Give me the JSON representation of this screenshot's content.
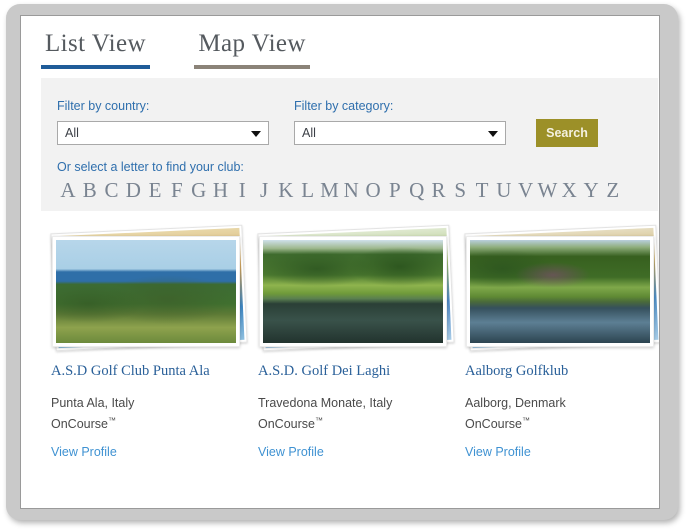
{
  "tabs": [
    {
      "label": "List View",
      "active": true
    },
    {
      "label": "Map View",
      "active": false
    }
  ],
  "filters": {
    "country": {
      "label": "Filter by country:",
      "value": "All",
      "caret_icon": "chevron-down-icon"
    },
    "category": {
      "label": "Filter by category:",
      "value": "All",
      "caret_icon": "chevron-down-icon"
    },
    "search_button": "Search",
    "letter_prompt": "Or select a letter to find your club:",
    "letters": [
      "A",
      "B",
      "C",
      "D",
      "E",
      "F",
      "G",
      "H",
      "I",
      "J",
      "K",
      "L",
      "M",
      "N",
      "O",
      "P",
      "Q",
      "R",
      "S",
      "T",
      "U",
      "V",
      "W",
      "X",
      "Y",
      "Z"
    ]
  },
  "cards": [
    {
      "title": "A.S.D Golf Club Punta Ala",
      "location": "Punta Ala, Italy",
      "provider": "OnCourse",
      "provider_mark": "™",
      "link": "View Profile",
      "photo_name": "golf-course-sea-view-photo"
    },
    {
      "title": "A.S.D. Golf Dei Laghi",
      "location": "Travedona Monate, Italy",
      "provider": "OnCourse",
      "provider_mark": "™",
      "link": "View Profile",
      "photo_name": "golf-course-lake-reflection-photo"
    },
    {
      "title": "Aalborg Golfklub",
      "location": "Aalborg, Denmark",
      "provider": "OnCourse",
      "provider_mark": "™",
      "link": "View Profile",
      "photo_name": "golf-course-pond-heather-photo"
    }
  ],
  "colors": {
    "active_tab_underline": "#1f5c99",
    "inactive_tab_underline": "#8b8378",
    "filter_label": "#2f6fad",
    "search_button_bg": "#9c9028",
    "card_title": "#2a6099",
    "card_link": "#3f92d2",
    "panel_bg": "#f2f2f2"
  }
}
